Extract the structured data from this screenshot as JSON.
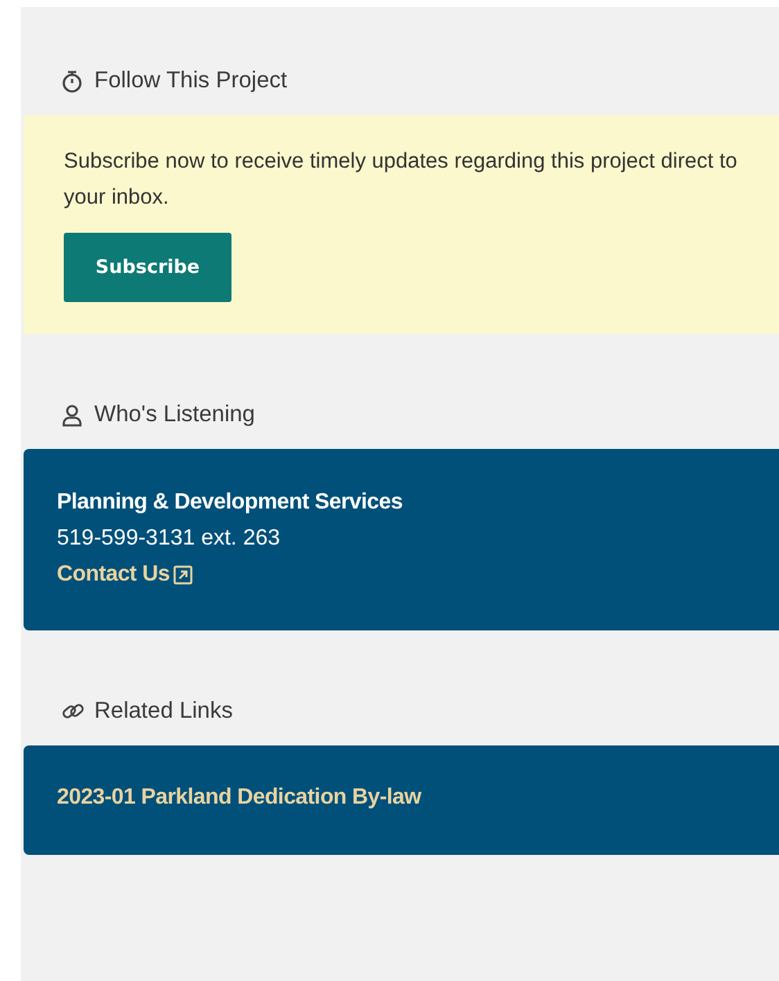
{
  "sections": [
    {
      "kind": "follow",
      "heading": "Follow This Project",
      "text": "Subscribe now to receive timely updates regarding this project direct to your inbox.",
      "button": "Subscribe"
    },
    {
      "kind": "contact",
      "heading": "Who's Listening",
      "name": "Planning & Development Services",
      "phone": "519-599-3131 ext. 263",
      "link": "Contact Us"
    },
    {
      "kind": "links",
      "heading": "Related Links",
      "links": [
        "2023-01 Parkland Dedication By-law"
      ]
    }
  ]
}
